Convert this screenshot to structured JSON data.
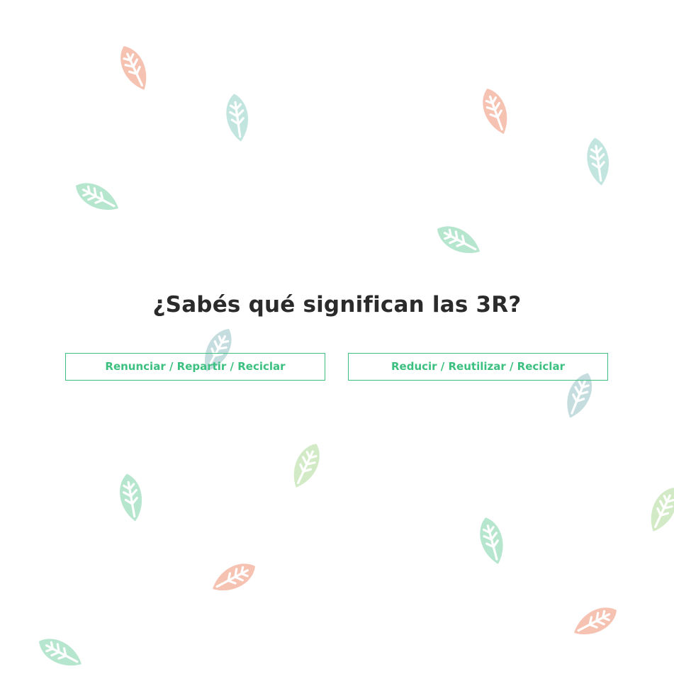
{
  "quiz": {
    "question": "¿Sabés qué significan las 3R?",
    "answers": [
      {
        "label": "Renunciar / Repartir / Reciclar"
      },
      {
        "label": "Reducir / Reutilizar / Reciclar"
      }
    ],
    "accent_color": "#3cc080"
  },
  "decoration": {
    "icon": "leaf-icon",
    "leaf_colors": {
      "salmon": "#f6c2b2",
      "teal": "#c2e6df",
      "mint": "#b7e6cf",
      "slate": "#c6dde0",
      "lime": "#d2ebc6"
    }
  }
}
